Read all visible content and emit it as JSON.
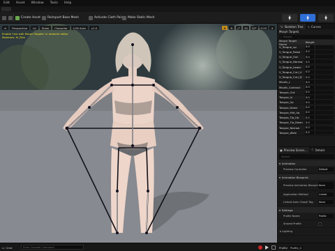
{
  "menubar": {
    "items": [
      "Edit",
      "Asset",
      "Window",
      "Tools",
      "Help"
    ]
  },
  "toolbar": {
    "create_asset": "Create Asset",
    "reimport": "Reimport Base Mesh",
    "activate_cloth": "Activate Cloth Paint",
    "make_static": "Make Static Mesh"
  },
  "viewport": {
    "chips": [
      "Perspective",
      "Lit",
      "Show",
      "Character",
      "LOD Auto",
      "x1.0"
    ],
    "right_tools": [
      "10",
      "10°",
      "0.25",
      "4"
    ],
    "warning_line1": "Enable 'Use with Morph Targets' in material editor",
    "warning_line2": "Materials: M_Skin"
  },
  "side": {
    "tab1": "Skeleton Tree",
    "tab2": "Curves",
    "title": "Morph Targets",
    "search_placeholder": "Search",
    "col_name": "Morph Target Name",
    "col_weight": "Weight",
    "morphs": [
      {
        "name": "V_Tongue_up",
        "weight": "0.0"
      },
      {
        "name": "V_Tongue_Raise",
        "weight": "0.0"
      },
      {
        "name": "V_Tongue_Out",
        "weight": "0.0"
      },
      {
        "name": "V_Tongue_Narrow",
        "weight": "0.0"
      },
      {
        "name": "V_Tongue_Lower",
        "weight": "0.0"
      },
      {
        "name": "V_Tongue_Curl_U",
        "weight": "0.0"
      },
      {
        "name": "V_Tongue_Curl_D",
        "weight": "0.0"
      },
      {
        "name": "Mouth_L",
        "weight": "0.0"
      },
      {
        "name": "Mouth_Contract",
        "weight": "0.0"
      },
      {
        "name": "Tongue_Out",
        "weight": "0.0"
      },
      {
        "name": "Tongue_In",
        "weight": "0.0"
      },
      {
        "name": "Tongue_Up",
        "weight": "0.0"
      },
      {
        "name": "Tongue_Down",
        "weight": "0.0"
      },
      {
        "name": "Tongue_Mid_Up",
        "weight": "0.0"
      },
      {
        "name": "Tongue_Tip_Up",
        "weight": "0.0"
      },
      {
        "name": "Tongue_Tip_Down",
        "weight": "0.0"
      },
      {
        "name": "Tongue_Narrow",
        "weight": "0.0"
      },
      {
        "name": "Tongue_Wide",
        "weight": "0.0"
      }
    ],
    "panel2_tab1": "Preview Scene...",
    "panel2_tab2": "Details",
    "details_search": "Search",
    "sections": {
      "animation": "Animation",
      "animation_blueprint": "Animation Blueprint",
      "settings": "Settings"
    },
    "rows": {
      "preview_controller": {
        "label": "Preview Controller",
        "value": "Default"
      },
      "preview_anim_bp": {
        "label": "Preview Animation Blueprint",
        "value": "None"
      },
      "application_method": {
        "label": "Application Method",
        "value": "Linked"
      },
      "linked_anim_graph_tag": {
        "label": "Linked Anim Graph Tag",
        "value": "None"
      },
      "profile_name": {
        "label": "Profile Name",
        "value": "Profile"
      },
      "shared_profile": {
        "label": "Shared Profile",
        "value": ""
      },
      "lighting": {
        "label": "Lighting",
        "value": ""
      }
    }
  },
  "bottombar": {
    "content_drawer": "Cmd",
    "console_placeholder": "Enter Console Command",
    "profile_label": "Profile",
    "profile_value": "Profile_0"
  }
}
